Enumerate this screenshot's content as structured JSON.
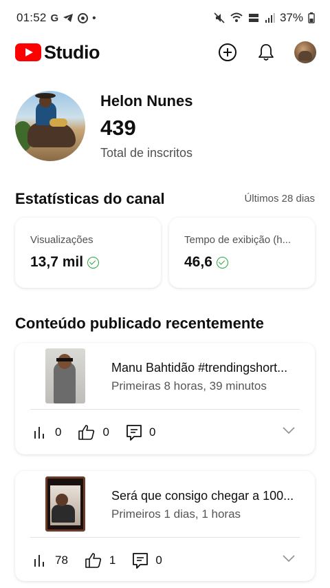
{
  "status_bar": {
    "time": "01:52",
    "left_glyphs": [
      "G",
      "•"
    ],
    "battery": "37%"
  },
  "header": {
    "logo_text": "Studio",
    "brand_color": "#ff0000",
    "actions": [
      "create-icon",
      "notifications-icon",
      "account-avatar"
    ]
  },
  "channel": {
    "name": "Helon Nunes",
    "subscriber_count": "439",
    "subscriber_label": "Total de inscritos"
  },
  "stats": {
    "title": "Estatísticas do canal",
    "period": "Últimos 28 dias",
    "cards": [
      {
        "label": "Visualizações",
        "value": "13,7 mil"
      },
      {
        "label": "Tempo de exibição (h...",
        "value": "46,6"
      }
    ],
    "check_color": "#2ba640"
  },
  "recent": {
    "title": "Conteúdo publicado recentemente",
    "videos": [
      {
        "title": "Manu Bahtidão #trendingshort...",
        "meta": "Primeiras 8 horas, 39 minutos",
        "views": "0",
        "likes": "0",
        "comments": "0"
      },
      {
        "title": "Será que consigo chegar a 100...",
        "meta": "Primeiros 1 dias, 1 horas",
        "views": "78",
        "likes": "1",
        "comments": "0"
      }
    ]
  }
}
